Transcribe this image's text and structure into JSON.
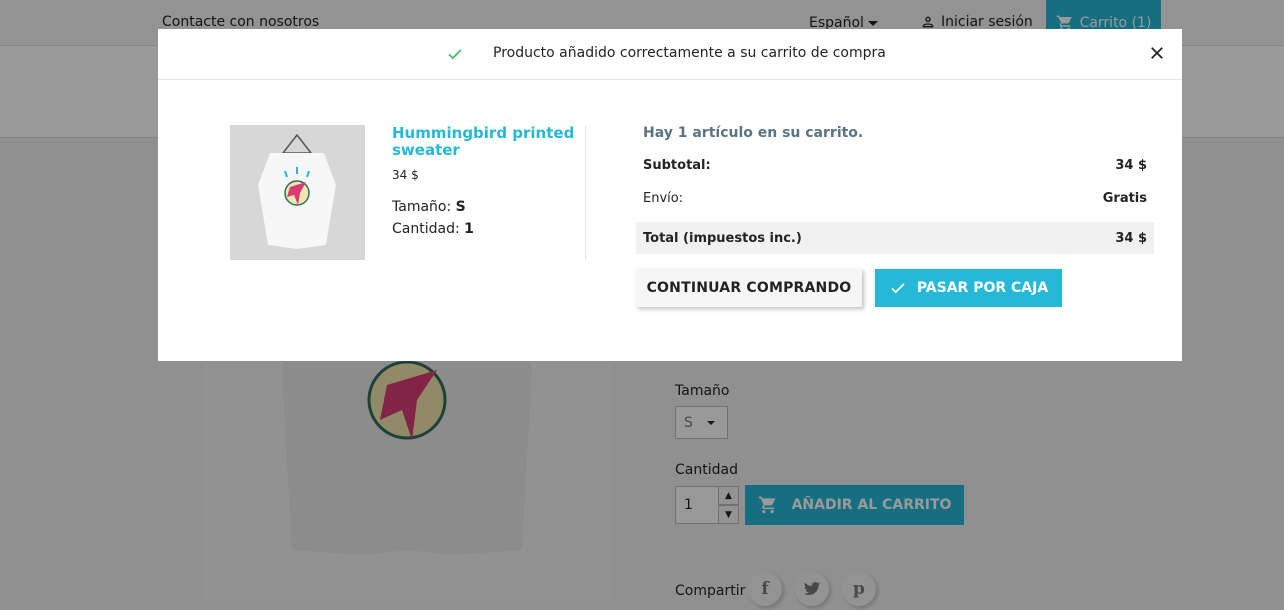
{
  "header": {
    "contact": "Contacte con nosotros",
    "language": "Español",
    "signin": "Iniciar sesión",
    "cart": "Carrito (1)"
  },
  "product_page": {
    "size_label": "Tamaño",
    "size_value": "S",
    "qty_label": "Cantidad",
    "qty_value": "1",
    "add_to_cart": "AÑADIR AL CARRITO",
    "share_label": "Compartir"
  },
  "modal": {
    "title": "Producto añadido correctamente a su carrito de compra",
    "product": {
      "name": "Hummingbird printed sweater",
      "price": "34 $",
      "size_label": "Tamaño:",
      "size_value": "S",
      "qty_label": "Cantidad:",
      "qty_value": "1"
    },
    "cart_count": "Hay 1 artículo en su carrito.",
    "subtotal_label": "Subtotal:",
    "subtotal_value": "34 $",
    "shipping_label": "Envío:",
    "shipping_value": "Gratis",
    "total_label": "Total (impuestos inc.)",
    "total_value": "34 $",
    "continue_button": "CONTINUAR COMPRANDO",
    "checkout_button": "PASAR POR CAJA"
  },
  "colors": {
    "accent": "#25b9d7",
    "success": "#4cbb6c"
  },
  "icons": [
    "check-icon",
    "close-icon",
    "person-icon",
    "cart-icon",
    "facebook-icon",
    "twitter-icon",
    "pinterest-icon"
  ]
}
